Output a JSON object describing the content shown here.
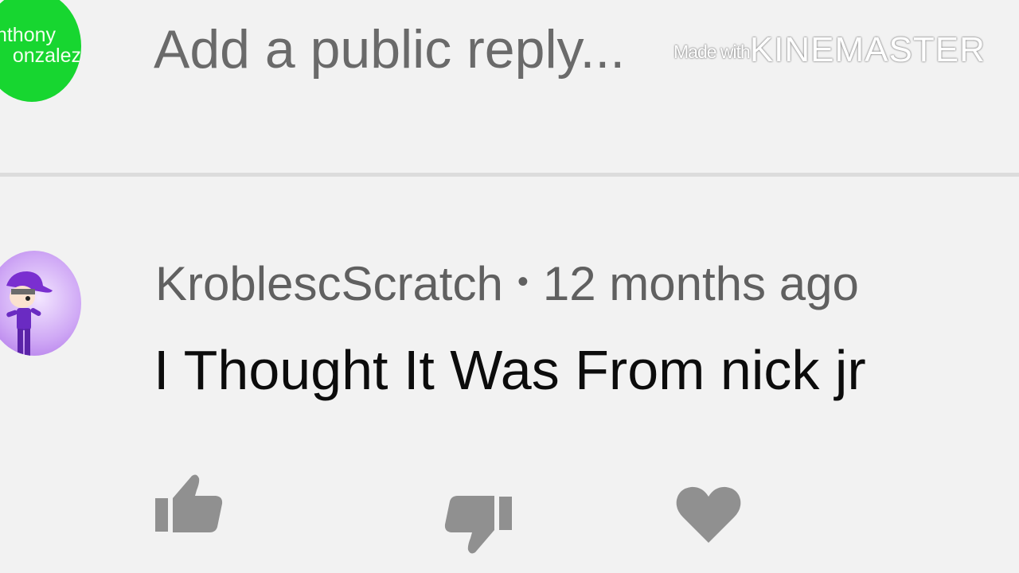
{
  "reply_bar": {
    "avatar_name_line1": "nthony",
    "avatar_name_line2": "onzalez",
    "avatar_color": "#17d630",
    "placeholder": "Add a public reply..."
  },
  "watermark": {
    "prefix": "Made with",
    "brand": "KINEMASTER"
  },
  "comment": {
    "author": "KroblescScratch",
    "separator": "•",
    "time": "12 months ago",
    "text": "I Thought It Was From nick jr",
    "avatar_icon": "purple-cap-character-avatar"
  },
  "actions": {
    "like_icon": "thumbs-up-icon",
    "dislike_icon": "thumbs-down-icon",
    "heart_icon": "heart-icon",
    "icon_color": "#909090"
  }
}
